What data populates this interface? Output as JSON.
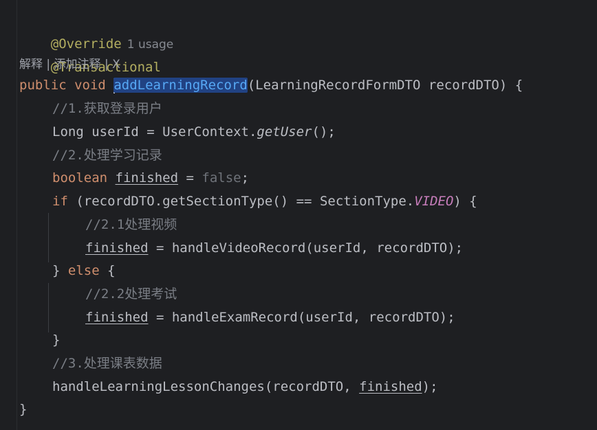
{
  "annotations": {
    "override": "@Override",
    "usages": "1 usage",
    "transactional": "@Transactional"
  },
  "codelens": {
    "explain": "解释",
    "sep1": " | ",
    "add_comment": "添加注释",
    "sep2": " | ",
    "close": "X"
  },
  "code": {
    "l_sig_public": "public",
    "l_sig_void": "void",
    "l_sig_method": "addLearningRecord",
    "l_sig_rest": "(LearningRecordFormDTO recordDTO) {",
    "c1": "//1.获取登录用户",
    "l_user_a": "Long userId = UserContext.",
    "l_user_fn": "getUser",
    "l_user_b": "();",
    "c2": "//2.处理学习记录",
    "l_bool_kw": "boolean",
    "l_bool_var": "finished",
    "l_bool_eq": " = ",
    "l_bool_false": "false",
    "l_bool_end": ";",
    "l_if_kw": "if",
    "l_if_a": " (recordDTO.getSectionType() == SectionType.",
    "l_if_const": "VIDEO",
    "l_if_b": ") {",
    "c21": "//2.1处理视频",
    "l_v_var": "finished",
    "l_v_rest": " = handleVideoRecord(userId, recordDTO);",
    "l_else_a": "} ",
    "l_else_kw": "else",
    "l_else_b": " {",
    "c22": "//2.2处理考试",
    "l_e_var": "finished",
    "l_e_rest": " = handleExamRecord(userId, recordDTO);",
    "l_close_if": "}",
    "c3": "//3.处理课表数据",
    "l_h_a": "handleLearningLessonChanges(recordDTO, ",
    "l_h_var": "finished",
    "l_h_b": ");",
    "l_close_method": "}"
  },
  "colors": {
    "background": "#1e1f22",
    "text": "#bcbec4",
    "keyword": "#cf8e6d",
    "annotation": "#b3ae60",
    "method_decl": "#56a8f5",
    "comment": "#7a7e85",
    "static_const": "#c77dbb"
  }
}
